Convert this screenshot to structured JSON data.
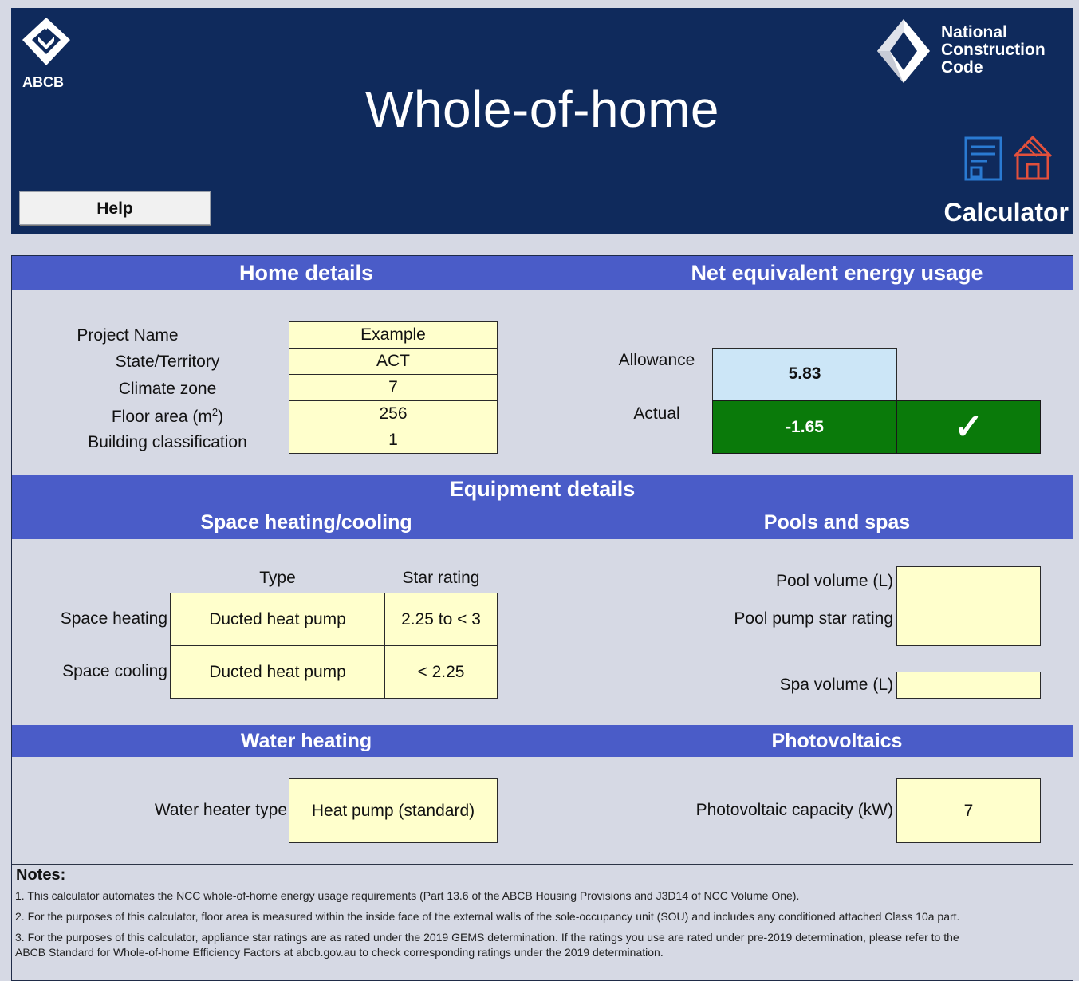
{
  "header": {
    "abcb_logo_text": "ABCB",
    "title": "Whole-of-home",
    "ncc_lines": [
      "National",
      "Construction",
      "Code"
    ],
    "calculator_label": "Calculator",
    "help_label": "Help"
  },
  "home_details": {
    "heading": "Home details",
    "rows": [
      {
        "label": "Project Name",
        "value": "Example"
      },
      {
        "label": "State/Territory",
        "value": "ACT"
      },
      {
        "label": "Climate zone",
        "value": "7"
      },
      {
        "label_prefix": "Floor area (m",
        "label_sup": "2",
        "label_suffix": ")",
        "value": "256"
      },
      {
        "label": "Building classification",
        "value": "1"
      }
    ]
  },
  "energy": {
    "heading": "Net equivalent energy usage",
    "allowance_label": "Allowance",
    "allowance_value": "5.83",
    "actual_label": "Actual",
    "actual_value": "-1.65",
    "status_symbol": "✓",
    "colors": {
      "allowance_bg": "#cce6f7",
      "actual_bg": "#0a7a0a"
    }
  },
  "equipment": {
    "heading": "Equipment details",
    "space": {
      "heading": "Space heating/cooling",
      "col_type": "Type",
      "col_star": "Star rating",
      "heating_label": "Space heating",
      "heating_type": "Ducted heat pump",
      "heating_star": "2.25 to < 3",
      "cooling_label": "Space cooling",
      "cooling_type": "Ducted heat pump",
      "cooling_star": "< 2.25"
    },
    "pools": {
      "heading": "Pools and spas",
      "pool_volume_label": "Pool volume (L)",
      "pool_volume_value": "",
      "pool_pump_label": "Pool pump star rating",
      "pool_pump_value": "",
      "spa_volume_label": "Spa volume (L)",
      "spa_volume_value": ""
    }
  },
  "water": {
    "heading": "Water heating",
    "label": "Water heater type",
    "value": "Heat pump (standard)"
  },
  "pv": {
    "heading": "Photovoltaics",
    "label": "Photovoltaic capacity (kW)",
    "value": "7"
  },
  "notes": {
    "heading": "Notes:",
    "lines": [
      "1. This calculator automates the NCC whole-of-home energy usage requirements (Part 13.6 of the ABCB Housing Provisions and J3D14 of NCC Volume One).",
      "2. For the purposes of this calculator, floor area is measured within the inside face of the external walls of the sole-occupancy unit (SOU) and includes any conditioned attached Class 10a part.",
      "3. For the purposes of this calculator, appliance star ratings are as rated under the 2019 GEMS determination. If the ratings you use are rated under pre-2019 determination, please refer to the",
      "ABCB Standard for Whole-of-home Efficiency Factors at abcb.gov.au to check corresponding ratings under the 2019 determination."
    ]
  },
  "colors": {
    "header_bg": "#0f2a5c",
    "band_bg": "#4a5cc8",
    "panel_bg": "#d6d9e4",
    "input_bg": "#ffffcc"
  }
}
